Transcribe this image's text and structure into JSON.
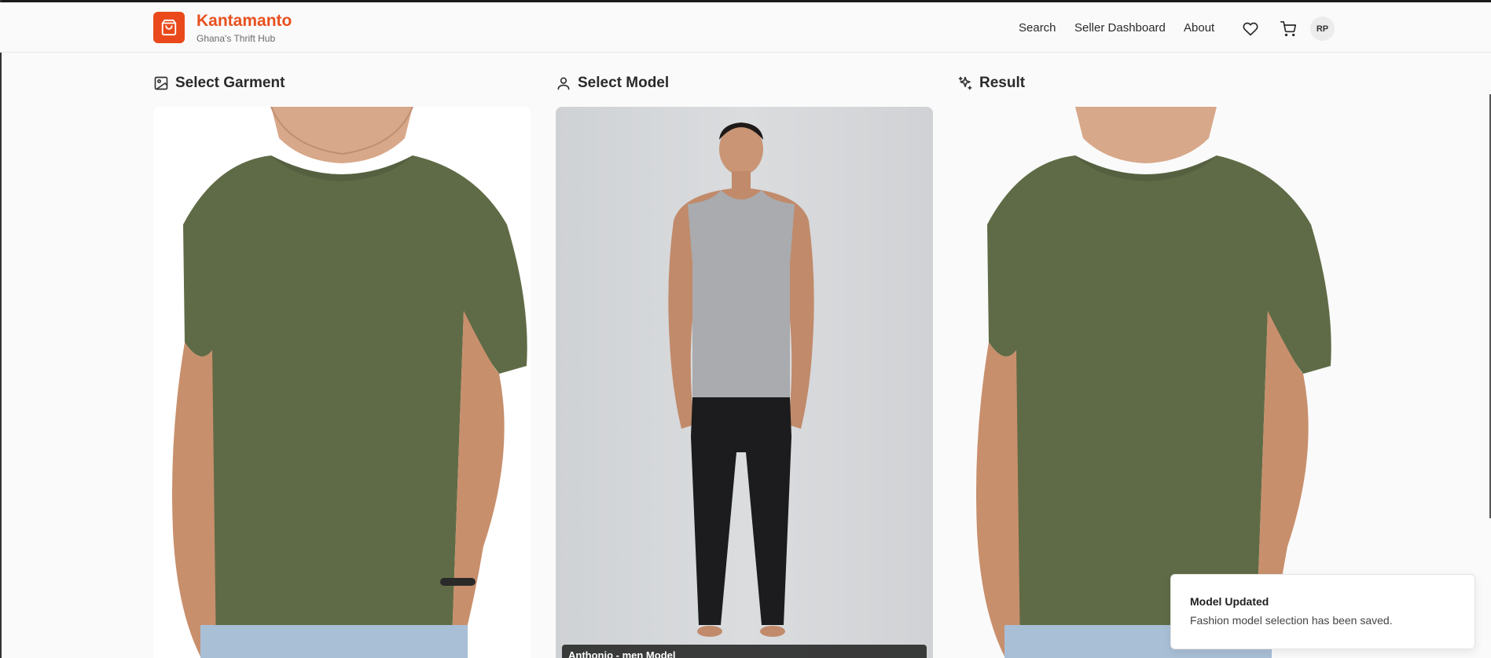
{
  "header": {
    "brand_name": "Kantamanto",
    "brand_tagline": "Ghana's Thrift Hub",
    "nav": {
      "search": "Search",
      "seller_dashboard": "Seller Dashboard",
      "about": "About"
    },
    "icons": [
      "shopping-bag-icon",
      "heart-icon",
      "cart-icon"
    ],
    "avatar_initials": "RP"
  },
  "sections": {
    "garment_title": "Select Garment",
    "model_title": "Select Model",
    "result_title": "Result"
  },
  "model": {
    "label": "Anthonio - men Model"
  },
  "toast": {
    "title": "Model Updated",
    "description": "Fashion model selection has been saved."
  },
  "colors": {
    "brand": "#e8501f",
    "garment": "#5f6b46",
    "model_bg": "#d6d8da"
  }
}
